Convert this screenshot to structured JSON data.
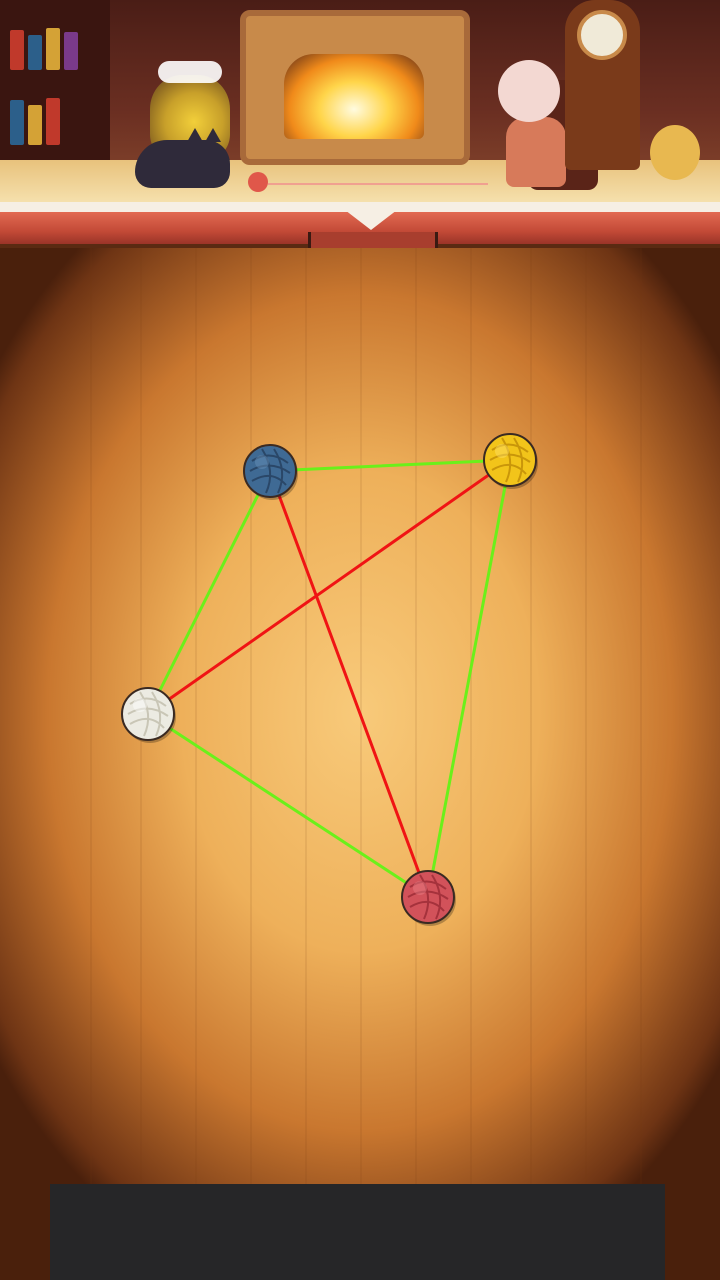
{
  "puzzle": {
    "yarn_balls": [
      {
        "id": "blue",
        "color": "#3f6a94",
        "dark": "#2a4768",
        "light": "#6b93bb"
      },
      {
        "id": "yellow",
        "color": "#f2c41a",
        "dark": "#c9960a",
        "light": "#ffe36a"
      },
      {
        "id": "white",
        "color": "#ecebe2",
        "dark": "#c9c6b6",
        "light": "#ffffff"
      },
      {
        "id": "red",
        "color": "#d2525a",
        "dark": "#a5323c",
        "light": "#ec8088"
      }
    ],
    "threads": [
      {
        "from": "blue",
        "to": "yellow",
        "state": "untangled",
        "color": "#6bf01a"
      },
      {
        "from": "blue",
        "to": "white",
        "state": "untangled",
        "color": "#6bf01a"
      },
      {
        "from": "yellow",
        "to": "red",
        "state": "untangled",
        "color": "#6bf01a"
      },
      {
        "from": "white",
        "to": "red",
        "state": "untangled",
        "color": "#6bf01a"
      },
      {
        "from": "blue",
        "to": "red",
        "state": "crossing",
        "color": "#f01414"
      },
      {
        "from": "yellow",
        "to": "white",
        "state": "crossing",
        "color": "#f01414"
      }
    ]
  }
}
